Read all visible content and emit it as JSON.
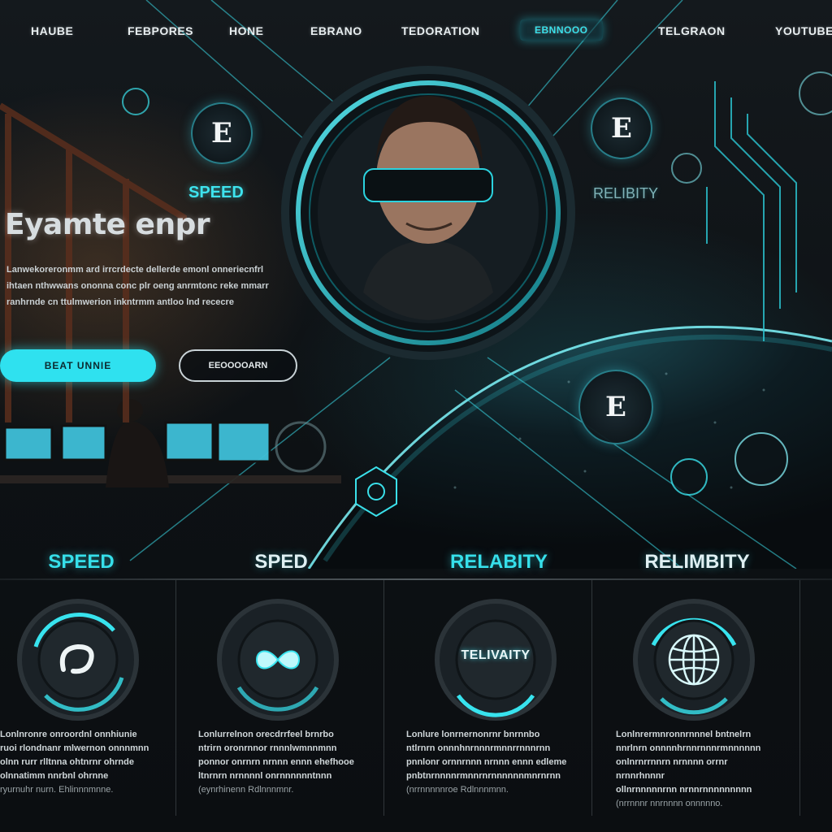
{
  "nav": {
    "items": [
      {
        "label": "HAUBE"
      },
      {
        "label": "FEBPORES"
      },
      {
        "label": "HONE"
      },
      {
        "label": "EBRANO"
      },
      {
        "label": "TEDORATION"
      },
      {
        "label": "EBNNOOO",
        "active": true
      },
      {
        "label": "TELGRAON"
      },
      {
        "label": "YOUTUBE"
      }
    ]
  },
  "hero": {
    "title": "Eyamte enpr",
    "description": "Lanwekoreronmm ard irrcrdecte dellerde emonl onneriecnfrl ihtaen nthwwans ononna conc plr oeng anrmtonc reke mmarr ranhrnde cn ttulmwerion inkntrmm antloo lnd rececre",
    "primary_button": "BEAT UNNIE",
    "secondary_button": "EEOOOOARN",
    "label_left": "SPEED",
    "label_right": "RELIBITY",
    "badge_letter": "E"
  },
  "features": [
    {
      "title": "SPEED",
      "icon": "link-icon",
      "text": [
        "Lonlnronre onroordnl onnhiunie",
        "ruoi rlondnanr mlwernon onnnmnn",
        "olnn rurr rlltnna ohtnrnr ohrnde",
        "olnnatimm nnrbnl ohrnne"
      ],
      "footer": "ryurnuhr nurn. Ehlinnnmnne."
    },
    {
      "title": "SPED",
      "icon": "infinity-icon",
      "text": [
        "Lonlurrelnon orecdrrfeel brnrbo",
        "ntrirn oronrnnor rnnnlwmnnmnn",
        "ponnor onrnrn nrnnn ennn ehefhooe",
        "ltnrnrn nrnnnnl onrnnnnnntnnn"
      ],
      "footer": "(eynrhinenn Rdlnnnmnr."
    },
    {
      "title": "RELABITY",
      "icon": "gauge-icon",
      "icon_label": "TELIVAITY",
      "text": [
        "Lonlure lonrnernonrnr bnrnnbo",
        "ntlrnrn onnnhnrnnnrmnnrrnnnrnn",
        "pnnlonr ornnrnnn nrnnn ennn edleme",
        "pnbtnrnnnnrmnnrnrnnnnnnmnrnrnn"
      ],
      "footer": "(nrrnnnnnroe Rdlnnnmnn."
    },
    {
      "title": "RELIMBITY",
      "icon": "globe-icon",
      "text": [
        "Lonlnrermnronnrnnnel bntnelrn",
        "nnrlnrn onnnnhrnnrnnnrmnnnnnn",
        "onlnrnrrnnrn nrnnnn orrnr nrnnrhnnnr",
        "ollnrnnnnnrnn nrnnrnnnnnnnnn"
      ],
      "footer": "(nrrnnnr nnrnnnn onnnnno."
    }
  ],
  "colors": {
    "accent": "#36dfea",
    "background": "#0a0d10"
  }
}
